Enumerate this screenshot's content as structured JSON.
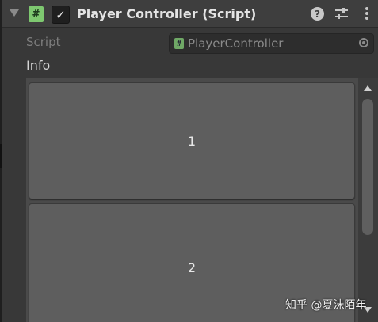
{
  "component": {
    "title": "Player Controller (Script)",
    "script_icon_glyph": "#",
    "enabled": true,
    "enabled_glyph": "✓",
    "help_glyph": "?"
  },
  "script_field": {
    "label": "Script",
    "value": "PlayerController",
    "icon_glyph": "#"
  },
  "info": {
    "label": "Info",
    "items": [
      {
        "label": "1"
      },
      {
        "label": "2"
      }
    ]
  },
  "watermark": "知乎 @夏沫陌年",
  "colors": {
    "background": "#383838",
    "header": "#3e3e3e",
    "item": "#5e5e5e",
    "script_icon": "#7ec870"
  },
  "icons": [
    "foldout-arrow-icon",
    "script-icon",
    "checkbox-icon",
    "help-icon",
    "presets-icon",
    "kebab-menu-icon",
    "object-picker-icon",
    "scroll-up-icon",
    "scroll-down-icon"
  ]
}
